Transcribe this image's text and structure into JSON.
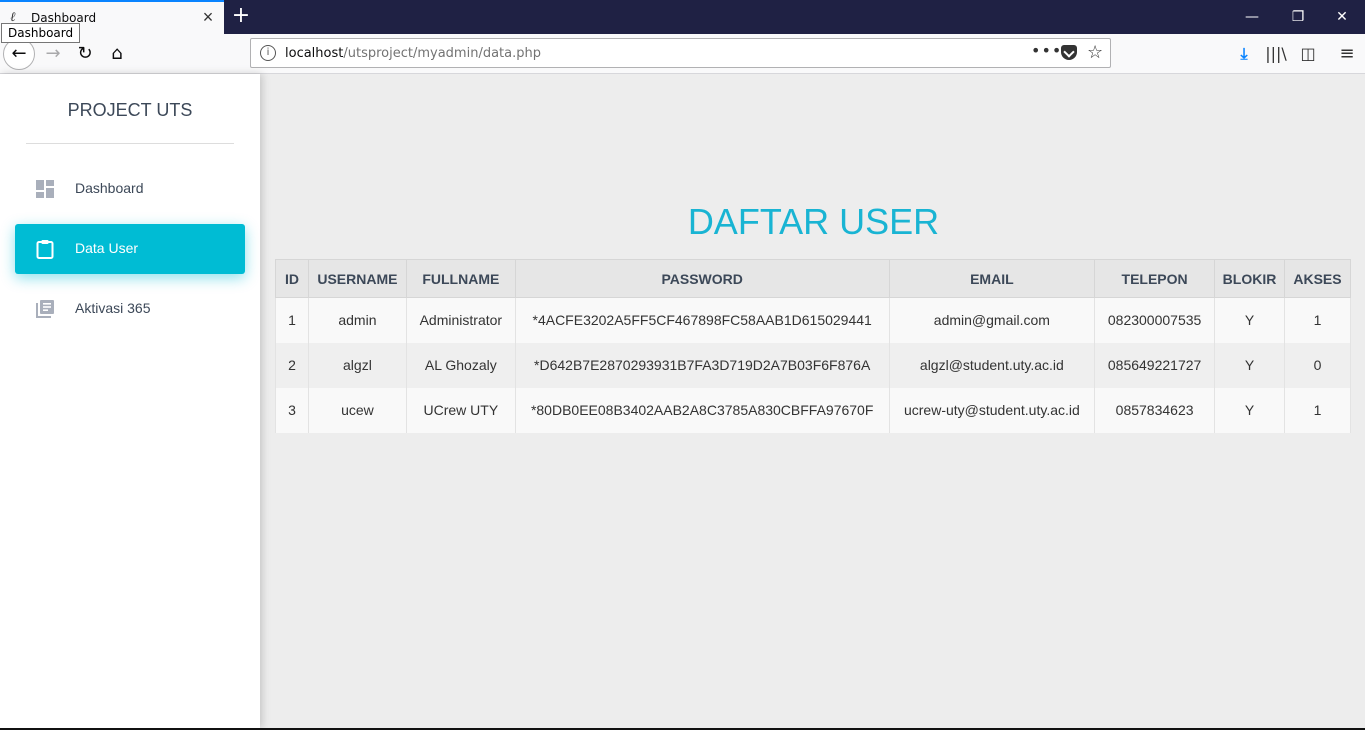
{
  "browser": {
    "tab_title": "Dashboard",
    "tooltip": "Dashboard",
    "url_host": "localhost",
    "url_path": "/utsproject/myadmin/data.php"
  },
  "sidebar": {
    "brand": "PROJECT UTS",
    "items": [
      {
        "label": "Dashboard",
        "icon": "dashboard-icon",
        "active": false
      },
      {
        "label": "Data User",
        "icon": "clipboard-icon",
        "active": true
      },
      {
        "label": "Aktivasi 365",
        "icon": "library-books-icon",
        "active": false
      }
    ]
  },
  "main": {
    "heading": "DAFTAR USER",
    "table": {
      "headers": [
        "ID",
        "USERNAME",
        "FULLNAME",
        "PASSWORD",
        "EMAIL",
        "TELEPON",
        "BLOKIR",
        "AKSES"
      ],
      "rows": [
        [
          "1",
          "admin",
          "Administrator",
          "*4ACFE3202A5FF5CF467898FC58AAB1D615029441",
          "admin@gmail.com",
          "082300007535",
          "Y",
          "1"
        ],
        [
          "2",
          "algzl",
          "AL Ghozaly",
          "*D642B7E2870293931B7FA3D719D2A7B03F6F876A",
          "algzl@student.uty.ac.id",
          "085649221727",
          "Y",
          "0"
        ],
        [
          "3",
          "ucew",
          "UCrew UTY",
          "*80DB0EE08B3402AAB2A8C3785A830CBFFA97670F",
          "ucrew-uty@student.uty.ac.id",
          "0857834623",
          "Y",
          "1"
        ]
      ]
    }
  },
  "colors": {
    "accent": "#00bcd4",
    "heading": "#19b4d3",
    "titlebar": "#1f2144"
  }
}
